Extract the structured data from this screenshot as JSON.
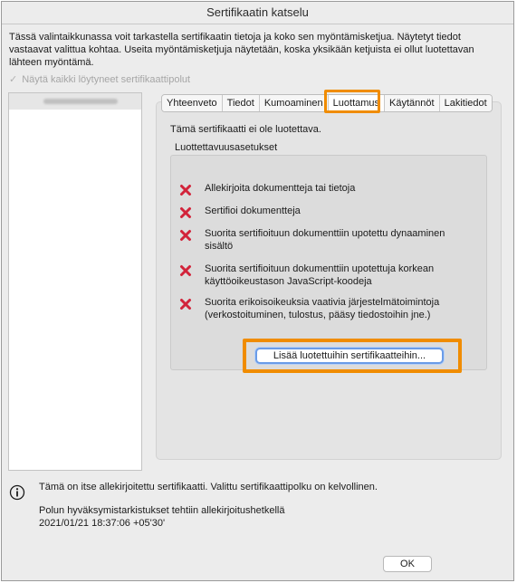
{
  "window": {
    "title": "Sertifikaatin katselu"
  },
  "intro": {
    "text": "Tässä valintaikkunassa voit tarkastella sertifikaatin tietoja ja koko sen myöntämisketjua. Näytetyt tiedot vastaavat valittua kohtaa. Useita myöntämisketjuja näytetään, koska yksikään ketjuista ei ollut luotettavan lähteen myöntämä."
  },
  "show_all": {
    "label": "Näytä kaikki löytyneet sertifikaattipolut",
    "checked": true
  },
  "tabs": [
    {
      "label": "Yhteenveto",
      "active": false
    },
    {
      "label": "Tiedot",
      "active": false
    },
    {
      "label": "Kumoaminen",
      "active": false
    },
    {
      "label": "Luottamus",
      "active": true
    },
    {
      "label": "Käytännöt",
      "active": false
    },
    {
      "label": "Lakitiedot",
      "active": false
    }
  ],
  "trust": {
    "status": "Tämä sertifikaatti ei ole luotettava.",
    "settings_heading": "Luottettavuusasetukset",
    "permissions": [
      "Allekirjoita dokumentteja tai tietoja",
      "Sertifioi dokumentteja",
      "Suorita sertifioituun dokumenttiin upotettu dynaaminen sisältö",
      "Suorita sertifioituun dokumenttiin upotettuja korkean käyttöoikeustason JavaScript-koodeja",
      "Suorita erikoisoikeuksia vaativia järjestelmätoimintoja (verkostoituminen, tulostus, pääsy tiedostoihin jne.)"
    ],
    "add_button": "Lisää luotettuihin sertifikaatteihin..."
  },
  "footer": {
    "info": "Tämä on itse allekirjoitettu sertifikaatti. Valittu sertifikaattipolku on kelvollinen.",
    "check_label": "Polun hyväksymistarkistukset tehtiin allekirjoitushetkellä",
    "timestamp": "2021/01/21 18:37:06 +05'30'",
    "ok_button": "OK"
  },
  "colors": {
    "highlight": "#f08c00",
    "deny_icon": "#d2233a",
    "focus_ring": "#6a9ce8"
  },
  "icons": {
    "permission": "x-mark-icon",
    "info": "info-icon"
  }
}
